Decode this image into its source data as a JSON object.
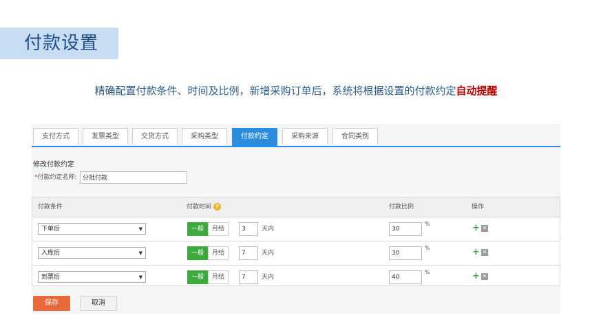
{
  "page_title": "付款设置",
  "subtitle_main": "精确配置付款条件、时间及比例，新增采购订单后，系统将根据设置的付款约定",
  "subtitle_highlight": "自动提醒",
  "tabs": [
    {
      "label": "支付方式"
    },
    {
      "label": "发票类型"
    },
    {
      "label": "交货方式"
    },
    {
      "label": "采购类型"
    },
    {
      "label": "付款约定"
    },
    {
      "label": "采购来源"
    },
    {
      "label": "合同类别"
    }
  ],
  "active_tab": "付款约定",
  "form": {
    "section_title": "修改付款约定",
    "required_mark": "*",
    "name_label": "付款约定名称:",
    "name_value": "分批付款"
  },
  "table": {
    "headers": {
      "condition": "付款条件",
      "time": "付款时间",
      "ratio": "付款比例",
      "action": "操作"
    },
    "rows": [
      {
        "condition": "下单后",
        "normal": "一般",
        "monthly": "月结",
        "days": "3",
        "days_unit": "天内",
        "ratio": "30",
        "pct": "%"
      },
      {
        "condition": "入库后",
        "normal": "一般",
        "monthly": "月结",
        "days": "7",
        "days_unit": "天内",
        "ratio": "30",
        "pct": "%"
      },
      {
        "condition": "到票后",
        "normal": "一般",
        "monthly": "月结",
        "days": "7",
        "days_unit": "天内",
        "ratio": "40",
        "pct": "%"
      }
    ]
  },
  "buttons": {
    "save": "保存",
    "cancel": "取消"
  },
  "colors": {
    "accent_blue": "#2b8de0",
    "green": "#3daa3d",
    "save_orange": "#e86a3a",
    "highlight_red": "#c00000"
  },
  "icons": {
    "help": "help-icon",
    "dropdown": "chevron-down-icon",
    "add": "plus-icon",
    "delete": "close-icon"
  }
}
